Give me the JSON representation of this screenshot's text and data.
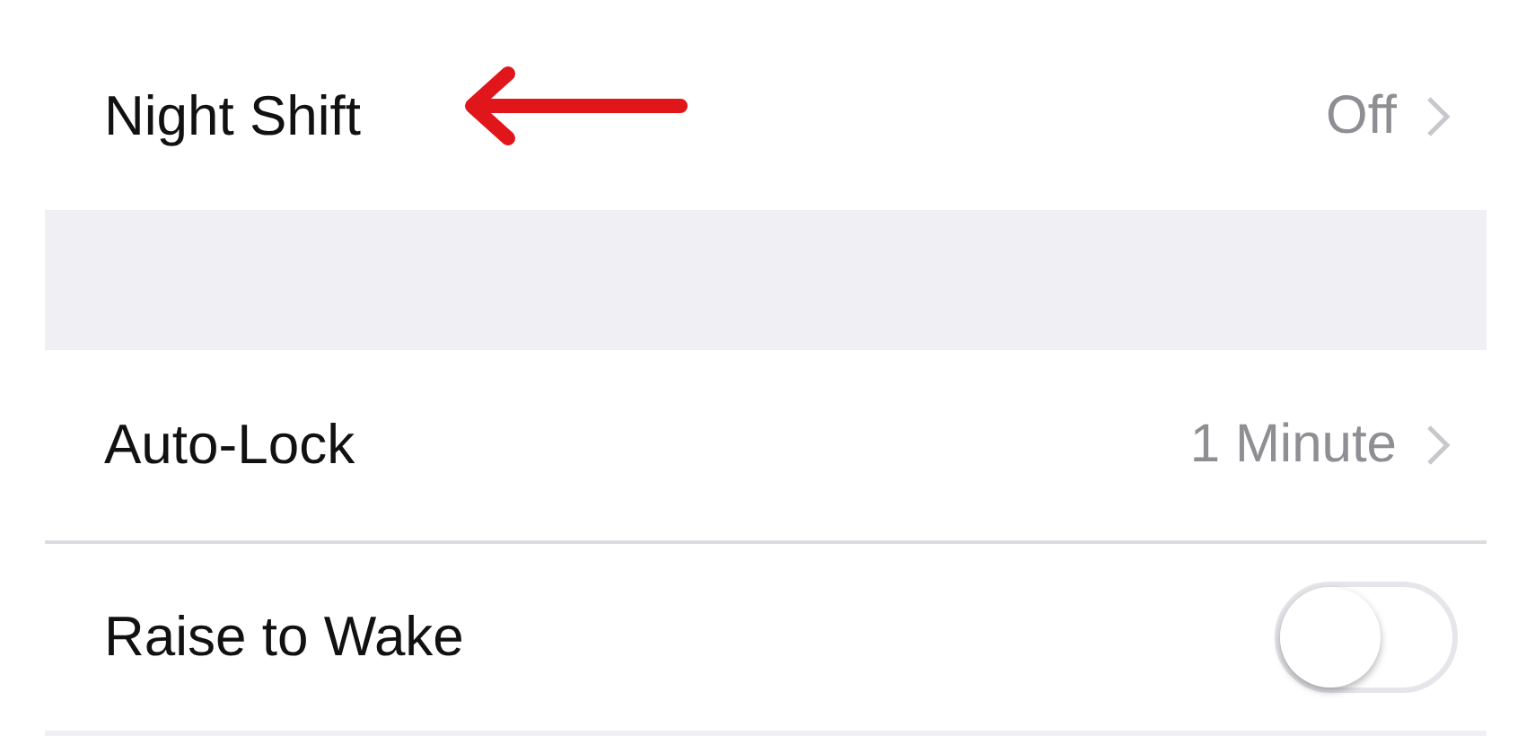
{
  "groups": [
    {
      "rows": [
        {
          "kind": "link",
          "label": "Night Shift",
          "value": "Off",
          "annotated": true
        }
      ]
    },
    {
      "rows": [
        {
          "kind": "link",
          "label": "Auto-Lock",
          "value": "1 Minute"
        },
        {
          "kind": "toggle",
          "label": "Raise to Wake",
          "on": false
        }
      ]
    }
  ]
}
